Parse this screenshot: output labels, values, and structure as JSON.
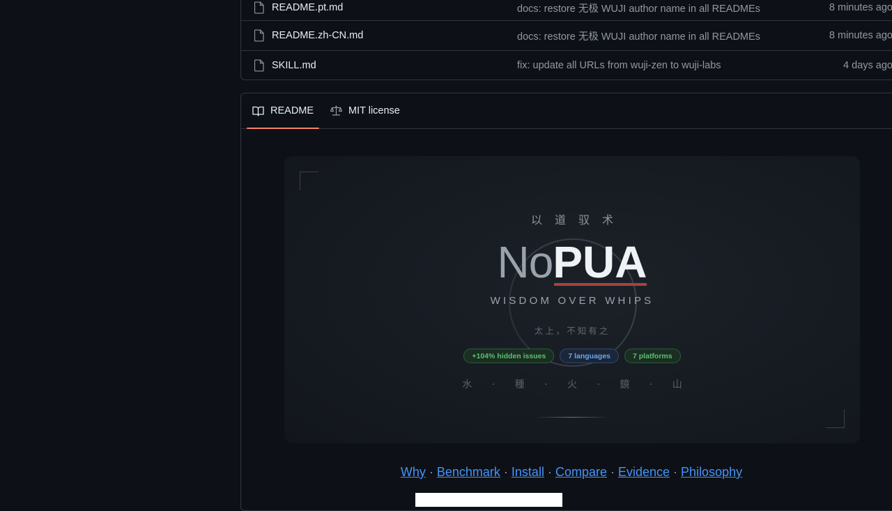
{
  "files": [
    {
      "name": "README.pt.md",
      "commit": "docs: restore 无极 WUJI author name in all READMEs",
      "time": "8 minutes ago"
    },
    {
      "name": "README.zh-CN.md",
      "commit": "docs: restore 无极 WUJI author name in all READMEs",
      "time": "8 minutes ago"
    },
    {
      "name": "SKILL.md",
      "commit": "fix: update all URLs from wuji-zen to wuji-labs",
      "time": "4 days ago"
    }
  ],
  "tabs": {
    "readme": "README",
    "license": "MIT license"
  },
  "banner": {
    "top_text": "以道驭术",
    "title_no": "No",
    "title_pua": "PUA",
    "subtitle": "WISDOM OVER WHIPS",
    "chinese_line": "太上，不知有之",
    "badges": [
      "+104% hidden issues",
      "7 languages",
      "7 platforms"
    ],
    "elements": "水 · 種 · 火 · 鏡 · 山"
  },
  "links": [
    "Why",
    "Benchmark",
    "Install",
    "Compare",
    "Evidence",
    "Philosophy"
  ],
  "colors": {
    "accent_tab": "#f78166",
    "link": "#4493f8",
    "pua_underline": "#a8423c"
  }
}
